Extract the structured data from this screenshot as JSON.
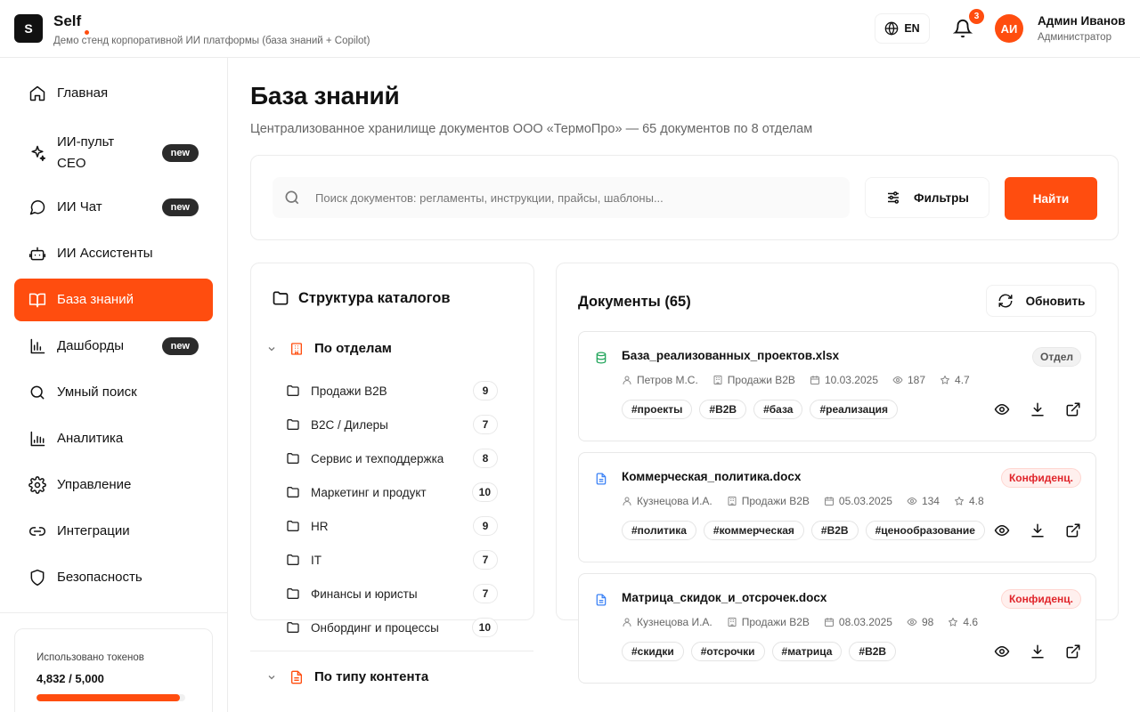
{
  "header": {
    "logo_letter": "S",
    "brand": "Self",
    "subtitle": "Демо стенд корпоративной ИИ платформы (база знаний + Copilot)",
    "lang": "EN",
    "notifications": "3",
    "user": {
      "initials": "АИ",
      "name": "Админ Иванов",
      "role": "Администратор"
    }
  },
  "sidebar": {
    "items": [
      {
        "label": "Главная",
        "icon": "home-icon"
      },
      {
        "label": "ИИ-пульт\nCEO",
        "icon": "sparkles-icon",
        "badge": "new"
      },
      {
        "label": "ИИ Чат",
        "icon": "chat-icon",
        "badge": "new"
      },
      {
        "label": "ИИ Ассистенты",
        "icon": "bot-icon"
      },
      {
        "label": "База знаний",
        "icon": "book-icon",
        "active": true
      },
      {
        "label": "Дашборды",
        "icon": "bar-chart-icon",
        "badge": "new"
      },
      {
        "label": "Умный поиск",
        "icon": "search-icon"
      },
      {
        "label": "Аналитика",
        "icon": "analytics-icon"
      },
      {
        "label": "Управление",
        "icon": "gear-icon"
      },
      {
        "label": "Интеграции",
        "icon": "link-icon"
      },
      {
        "label": "Безопасность",
        "icon": "shield-icon"
      }
    ],
    "tokens": {
      "label": "Использовано токенов",
      "value": "4,832 / 5,000",
      "fraction": 0.9664
    }
  },
  "main": {
    "title": "База знаний",
    "subtitle": "Централизованное хранилище документов ООО «ТермоПро» — 65 документов по 8 отделам",
    "search": {
      "placeholder": "Поиск документов: регламенты, инструкции, прайсы, шаблоны...",
      "value": "",
      "filters_label": "Фильтры",
      "find_label": "Найти"
    },
    "catalog": {
      "title": "Структура каталогов",
      "groups": [
        {
          "label": "По отделам",
          "folders": [
            {
              "name": "Продажи B2B",
              "count": "9"
            },
            {
              "name": "B2C / Дилеры",
              "count": "7"
            },
            {
              "name": "Сервис и техподдержка",
              "count": "8"
            },
            {
              "name": "Маркетинг и продукт",
              "count": "10"
            },
            {
              "name": "HR",
              "count": "9"
            },
            {
              "name": "IT",
              "count": "7"
            },
            {
              "name": "Финансы и юристы",
              "count": "7"
            },
            {
              "name": "Онбординг и процессы",
              "count": "10"
            }
          ]
        },
        {
          "label": "По типу контента"
        }
      ]
    },
    "docs": {
      "title": "Документы (65)",
      "refresh_label": "Обновить",
      "items": [
        {
          "name": "База_реализованных_проектов.xlsx",
          "type_icon": "spreadsheet-icon",
          "type_color": "#22a55b",
          "badge": "Отдел",
          "badge_kind": "dept",
          "author": "Петров М.С.",
          "dept": "Продажи B2B",
          "date": "10.03.2025",
          "views": "187",
          "rating": "4.7",
          "tags": [
            "#проекты",
            "#B2B",
            "#база",
            "#реализация"
          ]
        },
        {
          "name": "Коммерческая_политика.docx",
          "type_icon": "document-icon",
          "type_color": "#3b82f6",
          "badge": "Конфиденц.",
          "badge_kind": "conf",
          "author": "Кузнецова И.А.",
          "dept": "Продажи B2B",
          "date": "05.03.2025",
          "views": "134",
          "rating": "4.8",
          "tags": [
            "#политика",
            "#коммерческая",
            "#B2B",
            "#ценообразование"
          ]
        },
        {
          "name": "Матрица_скидок_и_отсрочек.docx",
          "type_icon": "document-icon",
          "type_color": "#3b82f6",
          "badge": "Конфиденц.",
          "badge_kind": "conf",
          "author": "Кузнецова И.А.",
          "dept": "Продажи B2B",
          "date": "08.03.2025",
          "views": "98",
          "rating": "4.6",
          "tags": [
            "#скидки",
            "#отсрочки",
            "#матрица",
            "#B2B"
          ]
        }
      ]
    }
  },
  "colors": {
    "accent": "#ff4d0f",
    "confidential": "#e0252b"
  }
}
